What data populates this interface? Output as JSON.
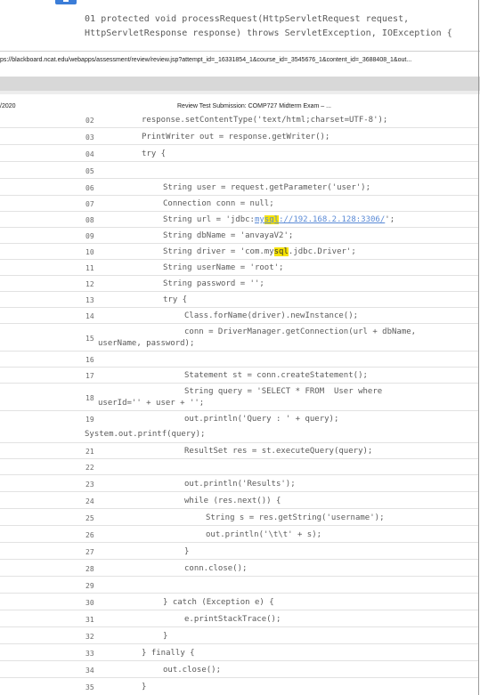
{
  "top": {
    "line01_a": "01 protected void processRequest(HttpServletRequest request,",
    "line01_b": "HttpServletResponse response) throws ServletException, IOException {"
  },
  "url": "ps://blackboard.ncat.edu/webapps/assessment/review/review.jsp?attempt_id=_16331854_1&course_id=_3545676_1&content_id=_3688408_1&out...",
  "date": "/2020",
  "page_title": "Review Test Submission: COMP727 Midterm Exam – ...",
  "lines": {
    "l02": {
      "n": "02",
      "t": "response.setContentType('text/html;charset=UTF-8');"
    },
    "l03": {
      "n": "03",
      "t": "PrintWriter out = response.getWriter();"
    },
    "l04": {
      "n": "04",
      "t": "try {"
    },
    "l05": {
      "n": "05",
      "t": ""
    },
    "l06": {
      "n": "06",
      "t": "String user = request.getParameter('user');"
    },
    "l07": {
      "n": "07",
      "t": "Connection conn = null;"
    },
    "l08": {
      "n": "08",
      "a": "String url = 'jdbc:",
      "u1": "my",
      "hl": "sql",
      "u2": "://192.168.2.128:3306/",
      "b": "';"
    },
    "l09": {
      "n": "09",
      "t": "String dbName = 'anvayaV2';"
    },
    "l10": {
      "n": "10",
      "a": "String driver = 'com.my",
      "hl": "sql",
      "b": ".jdbc.Driver';"
    },
    "l11": {
      "n": "11",
      "t": "String userName = 'root';"
    },
    "l12": {
      "n": "12",
      "t": "String password = '';"
    },
    "l13": {
      "n": "13",
      "t": "try {"
    },
    "l14": {
      "n": "14",
      "t": "Class.forName(driver).newInstance();"
    },
    "l15": {
      "n": "15",
      "t": "conn = DriverManager.getConnection(url + dbName,",
      "t2": "userName, password);"
    },
    "l16": {
      "n": "16",
      "t": ""
    },
    "l17": {
      "n": "17",
      "t": "Statement st = conn.createStatement();"
    },
    "l18": {
      "n": "18",
      "t": "String query = 'SELECT * FROM  User where",
      "t2": "userId='' + user + '';"
    },
    "l19": {
      "n": "19",
      "t": "out.println('Query : ' + query);",
      "t2": "System.out.printf(query);"
    },
    "l21": {
      "n": "21",
      "t": "ResultSet res = st.executeQuery(query);"
    },
    "l22": {
      "n": "22",
      "t": ""
    },
    "l23": {
      "n": "23",
      "t": "out.println('Results');"
    },
    "l24": {
      "n": "24",
      "t": "while (res.next()) {"
    },
    "l25": {
      "n": "25",
      "t": "String s = res.getString('username');"
    },
    "l26": {
      "n": "26",
      "t": "out.println('\\t\\t' + s);"
    },
    "l27": {
      "n": "27",
      "t": "}"
    },
    "l28": {
      "n": "28",
      "t": "conn.close();"
    },
    "l29": {
      "n": "29",
      "t": ""
    },
    "l30": {
      "n": "30",
      "t": "} catch (Exception e) {"
    },
    "l31": {
      "n": "31",
      "t": "e.printStackTrace();"
    },
    "l32": {
      "n": "32",
      "t": "}"
    },
    "l33": {
      "n": "33",
      "t": "} finally {"
    },
    "l34": {
      "n": "34",
      "t": "out.close();"
    },
    "l35": {
      "n": "35",
      "t": "}"
    }
  },
  "colors": {
    "highlight": "#f6e200",
    "link": "#5a8ad6",
    "text": "#5a5a5a"
  }
}
